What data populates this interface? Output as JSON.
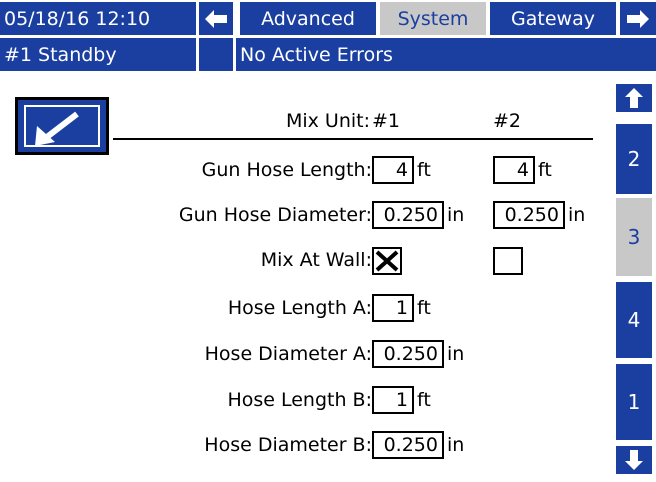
{
  "header": {
    "datetime": "05/18/16 12:10",
    "tabs": [
      {
        "label": "Advanced",
        "active": false
      },
      {
        "label": "System",
        "active": true
      },
      {
        "label": "Gateway",
        "active": false
      }
    ]
  },
  "status": {
    "unit_state": "#1 Standby",
    "errors": "No Active Errors"
  },
  "table": {
    "mix_unit_label": "Mix Unit:",
    "unit1": "#1",
    "unit2": "#2",
    "rows": [
      {
        "label": "Gun Hose Length:",
        "v1": "4",
        "u1": "ft",
        "v2": "4",
        "u2": "ft"
      },
      {
        "label": "Gun Hose Diameter:",
        "v1": "0.250",
        "u1": "in",
        "v2": "0.250",
        "u2": "in"
      },
      {
        "label": "Mix At Wall:",
        "v1_checked": true,
        "v2_checked": false
      },
      {
        "label": "Hose Length A:",
        "v1": "1",
        "u1": "ft"
      },
      {
        "label": "Hose Diameter A:",
        "v1": "0.250",
        "u1": "in"
      },
      {
        "label": "Hose Length B:",
        "v1": "1",
        "u1": "ft"
      },
      {
        "label": "Hose Diameter B:",
        "v1": "0.250",
        "u1": "in"
      }
    ]
  },
  "pages": [
    {
      "label": "2",
      "active": false
    },
    {
      "label": "3",
      "active": true
    },
    {
      "label": "4",
      "active": false
    },
    {
      "label": "1",
      "active": false
    }
  ],
  "icons": [
    "left-arrow-icon",
    "right-arrow-icon",
    "up-arrow-icon",
    "down-arrow-icon",
    "edit-arrow-icon",
    "checkmark-x-icon"
  ],
  "colors": {
    "accent": "#1a3fa0",
    "inactive": "#c8c8c8"
  }
}
